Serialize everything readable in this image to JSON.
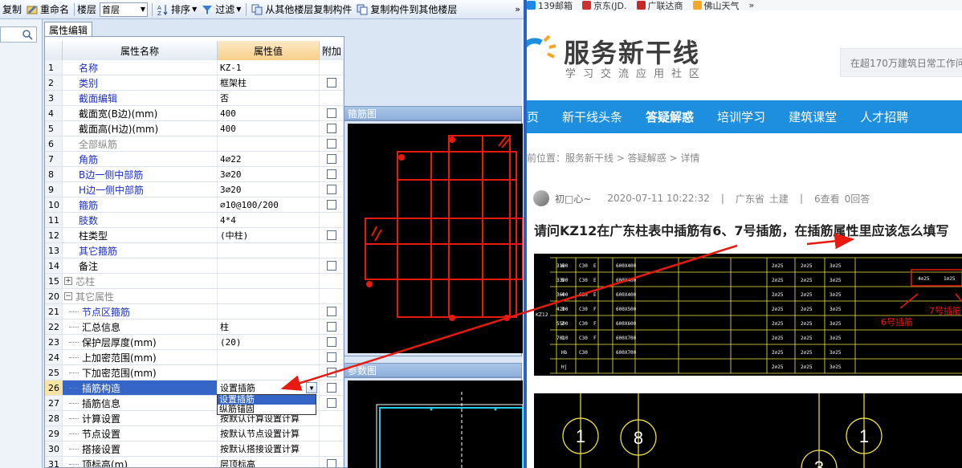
{
  "toolbar": {
    "copy": "复制",
    "rename": "重命名",
    "floor_label": "楼层",
    "floor_value": "首层",
    "sort": "排序",
    "filter": "过滤",
    "copy_from_floor": "从其他楼层复制构件",
    "copy_to_floor": "复制构件到其他楼层",
    "more": "»"
  },
  "panel": {
    "tab": "属性编辑",
    "columns": {
      "name": "属性名称",
      "value": "属性值",
      "extra": "附加"
    },
    "rows": [
      {
        "num": "1",
        "name": "名称",
        "value": "KZ-1",
        "style": "blue",
        "cb": false
      },
      {
        "num": "2",
        "name": "类别",
        "value": "框架柱",
        "style": "blue",
        "cb": true
      },
      {
        "num": "3",
        "name": "截面编辑",
        "value": "否",
        "style": "blue",
        "cb": false
      },
      {
        "num": "4",
        "name": "截面宽(B边)(mm)",
        "value": "400",
        "style": "",
        "cb": true
      },
      {
        "num": "5",
        "name": "截面高(H边)(mm)",
        "value": "400",
        "style": "",
        "cb": true
      },
      {
        "num": "6",
        "name": "全部纵筋",
        "value": "",
        "style": "gray",
        "cb": true
      },
      {
        "num": "7",
        "name": "角筋",
        "value": "4⌀22",
        "style": "blue",
        "cb": true
      },
      {
        "num": "8",
        "name": "B边一侧中部筋",
        "value": "3⌀20",
        "style": "blue",
        "cb": true
      },
      {
        "num": "9",
        "name": "H边一侧中部筋",
        "value": "3⌀20",
        "style": "blue",
        "cb": true
      },
      {
        "num": "10",
        "name": "箍筋",
        "value": "⌀10@100/200",
        "style": "blue",
        "cb": true
      },
      {
        "num": "11",
        "name": "肢数",
        "value": "4*4",
        "style": "blue",
        "cb": false
      },
      {
        "num": "12",
        "name": "柱类型",
        "value": "(中柱)",
        "style": "",
        "cb": true
      },
      {
        "num": "13",
        "name": "其它箍筋",
        "value": "",
        "style": "blue",
        "cb": false
      },
      {
        "num": "14",
        "name": "备注",
        "value": "",
        "style": "",
        "cb": true
      },
      {
        "num": "15",
        "name": "芯柱",
        "value": "",
        "style": "gray",
        "cb": false,
        "tree": "+"
      },
      {
        "num": "20",
        "name": "其它属性",
        "value": "",
        "style": "gray",
        "cb": false,
        "tree": "−"
      },
      {
        "num": "21",
        "name": "节点区箍筋",
        "value": "",
        "style": "blue",
        "cb": true,
        "child": true
      },
      {
        "num": "22",
        "name": "汇总信息",
        "value": "柱",
        "style": "",
        "cb": true,
        "child": true
      },
      {
        "num": "23",
        "name": "保护层厚度(mm)",
        "value": "(20)",
        "style": "",
        "cb": true,
        "child": true
      },
      {
        "num": "24",
        "name": "上加密范围(mm)",
        "value": "",
        "style": "",
        "cb": true,
        "child": true
      },
      {
        "num": "25",
        "name": "下加密范围(mm)",
        "value": "",
        "style": "",
        "cb": true,
        "child": true
      },
      {
        "num": "26",
        "name": "插筋构造",
        "value": "设置插筋",
        "style": "",
        "cb": true,
        "child": true,
        "selected": true
      },
      {
        "num": "27",
        "name": "插筋信息",
        "value": "",
        "style": "",
        "cb": true,
        "child": true
      },
      {
        "num": "28",
        "name": "计算设置",
        "value": "按默认计算设置计算",
        "style": "",
        "cb": false,
        "child": true
      },
      {
        "num": "29",
        "name": "节点设置",
        "value": "按默认节点设置计算",
        "style": "",
        "cb": false,
        "child": true
      },
      {
        "num": "30",
        "name": "搭接设置",
        "value": "按默认搭接设置计算",
        "style": "",
        "cb": false,
        "child": true
      },
      {
        "num": "31",
        "name": "顶标高(m)",
        "value": "层顶标高",
        "style": "",
        "cb": true,
        "child": true
      }
    ],
    "dropdown_options": [
      "设置插筋",
      "纵筋锚固"
    ]
  },
  "rebar_panel": {
    "title": "箍筋图"
  },
  "param_panel": {
    "title": "参数图"
  },
  "browser": {
    "bookmarks": [
      {
        "label": "139邮箱",
        "color": "#1e88e5"
      },
      {
        "label": "京东(JD.",
        "color": "#d32f2f"
      },
      {
        "label": "广联达商",
        "color": "#c62828"
      },
      {
        "label": "佛山天气",
        "color": "#f9a825"
      },
      {
        "label": "»",
        "color": ""
      }
    ],
    "logo_text": "服务新干线",
    "logo_sub": "学习交流应用社区",
    "search_placeholder": "在超170万建筑日常工作问",
    "nav": [
      "页",
      "新干线头条",
      "答疑解惑",
      "培训学习",
      "建筑课堂",
      "人才招聘"
    ],
    "breadcrumb": "前位置：服务新干线 > 答疑解惑 > 详情",
    "author": "初□心~",
    "datetime": "2020-07-11 10:22:32",
    "sep1": "|",
    "region": "广东省",
    "category": "土建",
    "sep2": "|",
    "views": "6查看",
    "answers": "0回答",
    "question_title": "请问KZ12在广东柱表中插筋有6、7号插筋，在插筋属性里应该怎么填写"
  },
  "table_image": {
    "rows": [
      [
        "6",
        "3100",
        "C30",
        "E",
        "600X400"
      ],
      [
        "5",
        "3300",
        "C30",
        "E",
        "600X400"
      ],
      [
        "4",
        "3600",
        "C30",
        "E",
        "600X400"
      ],
      [
        "3",
        "4200",
        "C30",
        "F",
        "600X500"
      ],
      [
        "2",
        "5500",
        "C30",
        "F",
        "600X600"
      ],
      [
        "1",
        "7010",
        "C30",
        "F",
        "600X700"
      ],
      [
        "Hb",
        "",
        "C30",
        "",
        "600X700"
      ],
      [
        "Hj",
        "",
        "",
        "",
        ""
      ]
    ],
    "col_id": "KZ12",
    "annotation_6": "6号插筋",
    "annotation_7": "7号插筋",
    "note_a": "4⌀25",
    "note_b": "1⌀25"
  },
  "drawing_image": {
    "labels": [
      "1",
      "8",
      "1",
      "3"
    ]
  },
  "colors": {
    "annotation": "#e8190e",
    "nav_blue": "#1e8fdf",
    "selection": "#3565c6"
  }
}
